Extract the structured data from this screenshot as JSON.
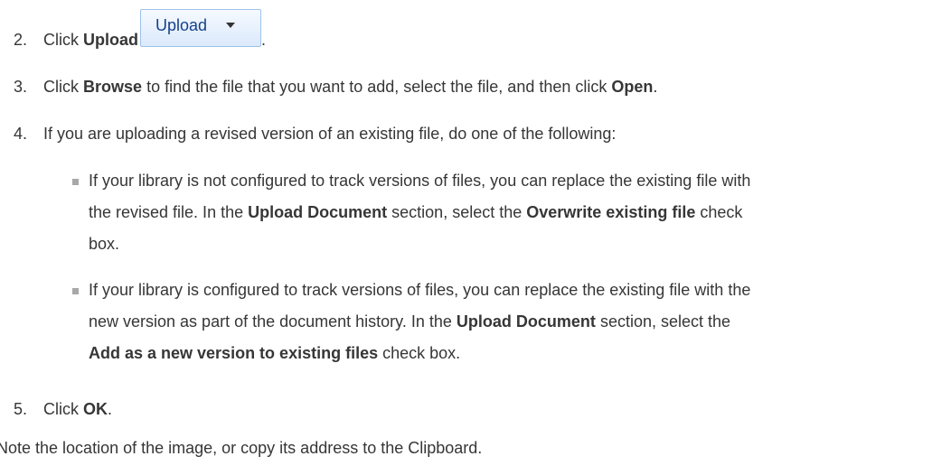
{
  "steps": {
    "s2": {
      "num": "2.",
      "pre": "Click",
      "bold": "Upload",
      "post": "."
    },
    "upload_button": {
      "label": "Upload"
    },
    "s3": {
      "num": "3.",
      "a": "Click",
      "b1": "Browse",
      "c": "to find the file that you want to add, select the file, and then click",
      "b2": "Open",
      "d": "."
    },
    "s4": {
      "num": "4.",
      "text": "If you are uploading a revised version of an existing file, do one of the following:"
    },
    "s5": {
      "num": "5.",
      "pre": "Click",
      "bold": "OK",
      "post": "."
    }
  },
  "bullets": [
    {
      "l1": "If your library is not configured to track versions of files, you can replace the existing file with",
      "l2a": "the revised file. In the",
      "l2b": "Upload Document",
      "l2c": "section, select the",
      "l2d": "Overwrite existing file",
      "l2e": "check",
      "l3": "box."
    },
    {
      "l1": "If your library is configured to track versions of files, you can replace the existing file with the",
      "l2a": "new version as part of the document history. In the",
      "l2b": "Upload Document",
      "l2c": "section, select the",
      "l3b": "Add as a new version to existing files",
      "l3c": "check box."
    }
  ],
  "note": "Note the location of the image, or copy its address to the Clipboard."
}
